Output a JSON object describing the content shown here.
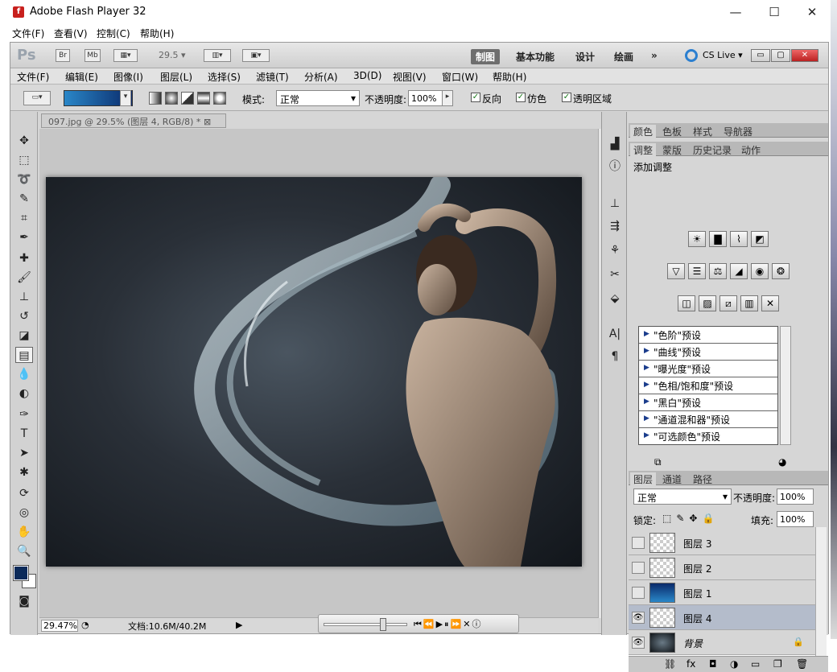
{
  "window": {
    "title": "Adobe Flash Player 32",
    "minimize": "—",
    "maximize": "☐",
    "close": "✕"
  },
  "fp_menu": [
    "文件(F)",
    "查看(V)",
    "控制(C)",
    "帮助(H)"
  ],
  "appbar": {
    "logo": "Ps",
    "br": "Br",
    "mb": "Mb",
    "zoom": "29.5",
    "workspaces": [
      "制图",
      "基本功能",
      "设计",
      "绘画"
    ],
    "more": "»",
    "cs_live": "CS Live"
  },
  "ps_menu": [
    "文件(F)",
    "编辑(E)",
    "图像(I)",
    "图层(L)",
    "选择(S)",
    "滤镜(T)",
    "分析(A)",
    "3D(D)",
    "视图(V)",
    "窗口(W)",
    "帮助(H)"
  ],
  "options": {
    "mode_label": "模式:",
    "mode_value": "正常",
    "opacity_label": "不透明度:",
    "opacity_value": "100%",
    "reverse": "反向",
    "dither": "仿色",
    "transparency": "透明区域"
  },
  "document": {
    "tab": "097.jpg @ 29.5% (图层 4, RGB/8) *",
    "zoom": "29.47%",
    "doc_size": "文档:10.6M/40.2M"
  },
  "panel_tabs_1": [
    "颜色",
    "色板",
    "样式",
    "导航器"
  ],
  "panel_tabs_2": [
    "调整",
    "蒙版",
    "历史记录",
    "动作"
  ],
  "adjust": {
    "title": "添加调整",
    "presets": [
      "\"色阶\"预设",
      "\"曲线\"预设",
      "\"曝光度\"预设",
      "\"色相/饱和度\"预设",
      "\"黑白\"预设",
      "\"通道混和器\"预设",
      "\"可选颜色\"预设"
    ]
  },
  "layers_tabs": [
    "图层",
    "通道",
    "路径"
  ],
  "layers": {
    "blend": "正常",
    "opacity_label": "不透明度:",
    "opacity_value": "100%",
    "lock_label": "锁定:",
    "fill_label": "填充:",
    "fill_value": "100%",
    "items": [
      {
        "name": "图层 3",
        "visible": false
      },
      {
        "name": "图层 2",
        "visible": false
      },
      {
        "name": "图层 1",
        "visible": false
      },
      {
        "name": "图层 4",
        "visible": true
      },
      {
        "name": "背景",
        "visible": true
      }
    ]
  },
  "colors": {
    "foreground": "#0b2a5a",
    "background": "#ffffff"
  }
}
